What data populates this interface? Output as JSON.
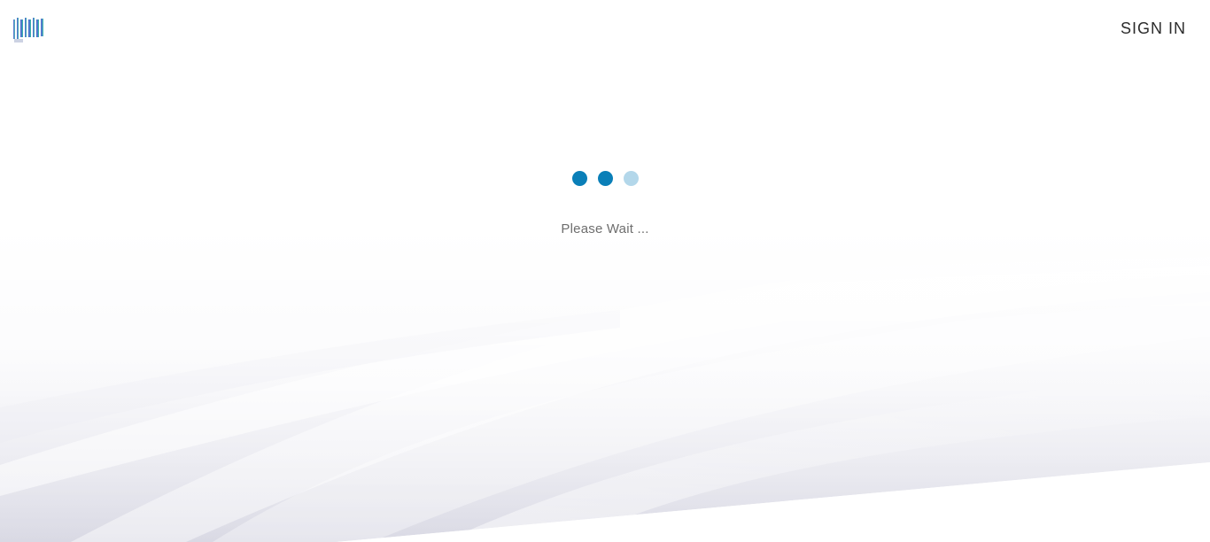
{
  "header": {
    "logo_icon": "brand-logo-icon",
    "sign_in_label": "SIGN IN"
  },
  "loader": {
    "status_text": "Please Wait ...",
    "dot_color": "#0a7fb8",
    "dot_faded_color": "#b3d7ea",
    "dots_active": 2,
    "dots_total": 3
  },
  "colors": {
    "background": "#ffffff",
    "wave_tint": "#dcdce6",
    "text_dark": "#2b2b2b",
    "text_muted": "#6e6e6e"
  }
}
